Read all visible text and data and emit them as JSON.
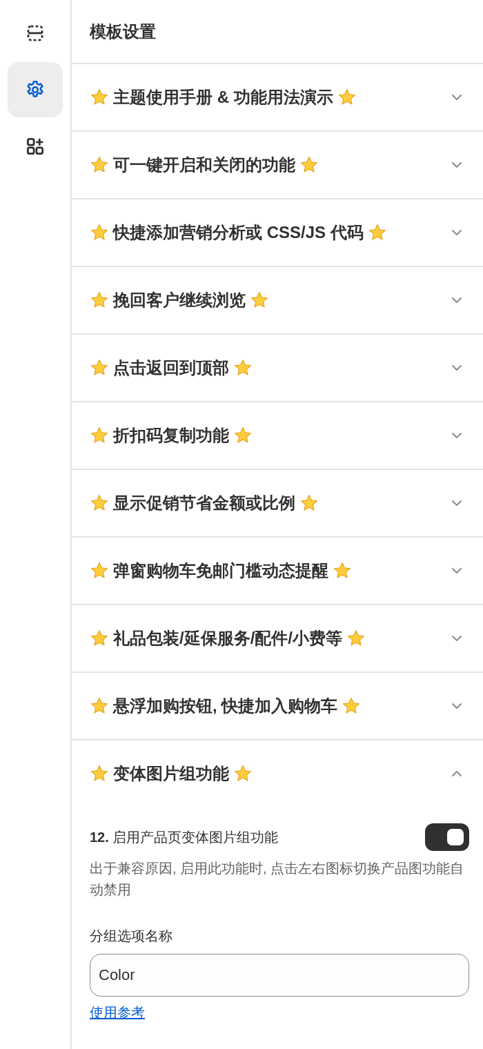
{
  "sidebar": {
    "items": [
      {
        "kind": "sections",
        "selected": false
      },
      {
        "kind": "settings",
        "selected": true
      },
      {
        "kind": "apps",
        "selected": false
      }
    ]
  },
  "header": {
    "title": "模板设置"
  },
  "sections": [
    {
      "title": "主题使用手册 & 功能用法演示",
      "expanded": false
    },
    {
      "title": "可一键开启和关闭的功能",
      "expanded": false
    },
    {
      "title": "快捷添加营销分析或 CSS/JS 代码",
      "expanded": false
    },
    {
      "title": "挽回客户继续浏览",
      "expanded": false
    },
    {
      "title": "点击返回到顶部",
      "expanded": false
    },
    {
      "title": "折扣码复制功能",
      "expanded": false
    },
    {
      "title": "显示促销节省金额或比例",
      "expanded": false
    },
    {
      "title": "弹窗购物车免邮门槛动态提醒",
      "expanded": false
    },
    {
      "title": "礼品包装/延保服务/配件/小费等",
      "expanded": false
    },
    {
      "title": "悬浮加购按钮, 快捷加入购物车",
      "expanded": false
    },
    {
      "title": "变体图片组功能",
      "expanded": true,
      "settings": [
        {
          "kind": "toggle",
          "label": "**12.** 启用产品页变体图片组功能",
          "on": true,
          "help": "出于兼容原因, 启用此功能时, 点击左右图标切换产品图功能自动禁用"
        },
        {
          "kind": "text",
          "label": "分组选项名称",
          "value": "Color",
          "link": "使用参考"
        }
      ]
    }
  ]
}
